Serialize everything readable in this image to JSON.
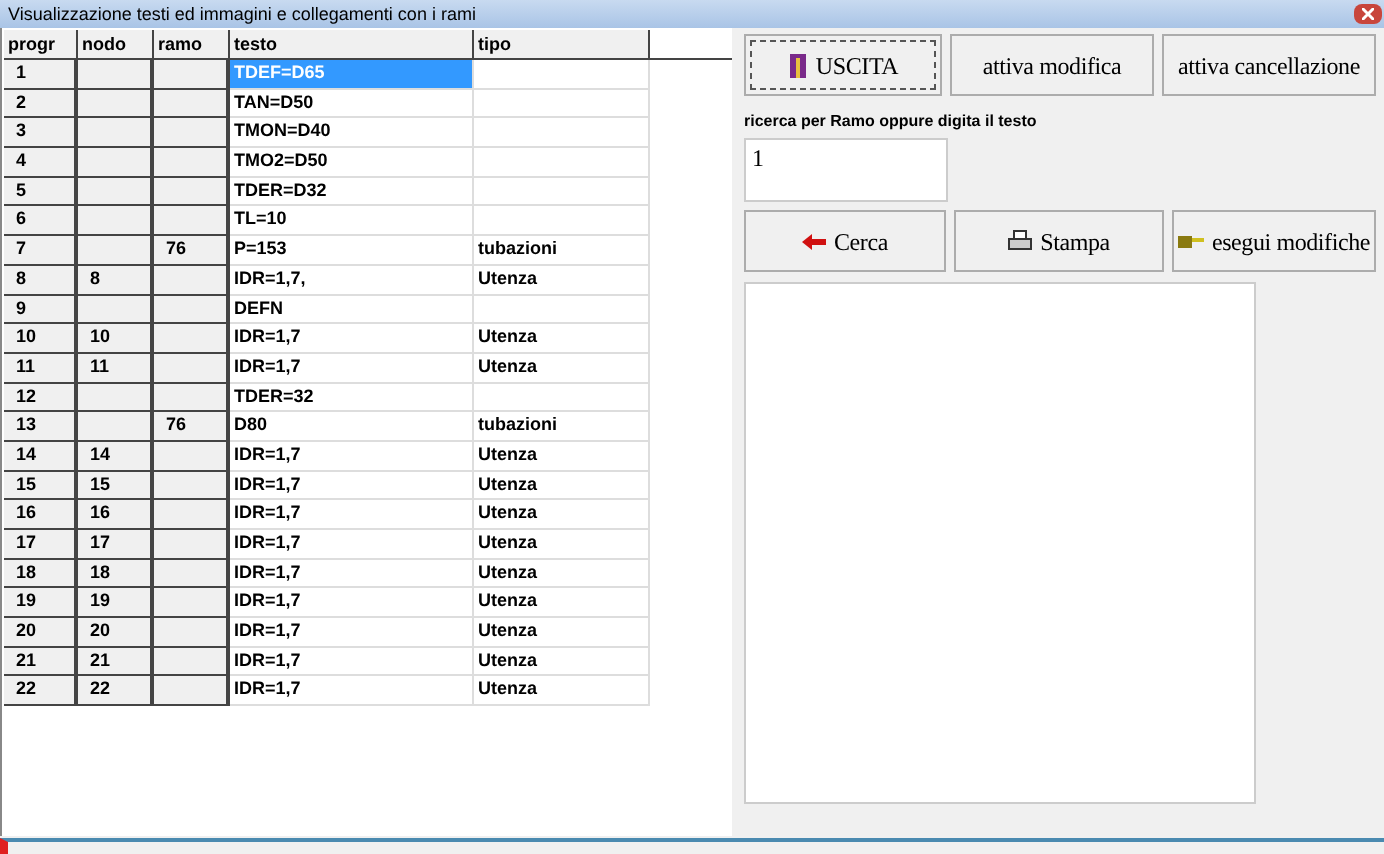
{
  "window": {
    "title": "Visualizzazione testi ed immagini  e collegamenti con i rami"
  },
  "table": {
    "columns": [
      "progr",
      "nodo",
      "ramo",
      "testo",
      "tipo"
    ],
    "rows": [
      {
        "progr": "1",
        "nodo": "",
        "ramo": "",
        "testo": "TDEF=D65",
        "tipo": "",
        "selected": true
      },
      {
        "progr": "2",
        "nodo": "",
        "ramo": "",
        "testo": "TAN=D50",
        "tipo": "",
        "selected": false
      },
      {
        "progr": "3",
        "nodo": "",
        "ramo": "",
        "testo": "TMON=D40",
        "tipo": "",
        "selected": false
      },
      {
        "progr": "4",
        "nodo": "",
        "ramo": "",
        "testo": "TMO2=D50",
        "tipo": "",
        "selected": false
      },
      {
        "progr": "5",
        "nodo": "",
        "ramo": "",
        "testo": "TDER=D32",
        "tipo": "",
        "selected": false
      },
      {
        "progr": "6",
        "nodo": "",
        "ramo": "",
        "testo": "TL=10",
        "tipo": "",
        "selected": false
      },
      {
        "progr": "7",
        "nodo": "",
        "ramo": "76",
        "testo": "P=153",
        "tipo": "tubazioni",
        "selected": false
      },
      {
        "progr": "8",
        "nodo": "8",
        "ramo": "",
        "testo": "IDR=1,7,",
        "tipo": "Utenza",
        "selected": false
      },
      {
        "progr": "9",
        "nodo": "",
        "ramo": "",
        "testo": "DEFN",
        "tipo": "",
        "selected": false
      },
      {
        "progr": "10",
        "nodo": "10",
        "ramo": "",
        "testo": "IDR=1,7",
        "tipo": "Utenza",
        "selected": false
      },
      {
        "progr": "11",
        "nodo": "11",
        "ramo": "",
        "testo": "IDR=1,7",
        "tipo": "Utenza",
        "selected": false
      },
      {
        "progr": "12",
        "nodo": "",
        "ramo": "",
        "testo": "TDER=32",
        "tipo": "",
        "selected": false
      },
      {
        "progr": "13",
        "nodo": "",
        "ramo": "76",
        "testo": "D80",
        "tipo": "tubazioni",
        "selected": false
      },
      {
        "progr": "14",
        "nodo": "14",
        "ramo": "",
        "testo": "IDR=1,7",
        "tipo": "Utenza",
        "selected": false
      },
      {
        "progr": "15",
        "nodo": "15",
        "ramo": "",
        "testo": "IDR=1,7",
        "tipo": "Utenza",
        "selected": false
      },
      {
        "progr": "16",
        "nodo": "16",
        "ramo": "",
        "testo": "IDR=1,7",
        "tipo": "Utenza",
        "selected": false
      },
      {
        "progr": "17",
        "nodo": "17",
        "ramo": "",
        "testo": "IDR=1,7",
        "tipo": "Utenza",
        "selected": false
      },
      {
        "progr": "18",
        "nodo": "18",
        "ramo": "",
        "testo": "IDR=1,7",
        "tipo": "Utenza",
        "selected": false
      },
      {
        "progr": "19",
        "nodo": "19",
        "ramo": "",
        "testo": "IDR=1,7",
        "tipo": "Utenza",
        "selected": false
      },
      {
        "progr": "20",
        "nodo": "20",
        "ramo": "",
        "testo": "IDR=1,7",
        "tipo": "Utenza",
        "selected": false
      },
      {
        "progr": "21",
        "nodo": "21",
        "ramo": "",
        "testo": "IDR=1,7",
        "tipo": "Utenza",
        "selected": false
      },
      {
        "progr": "22",
        "nodo": "22",
        "ramo": "",
        "testo": "IDR=1,7",
        "tipo": "Utenza",
        "selected": false
      }
    ]
  },
  "top_buttons": [
    {
      "label": "USCITA",
      "kind": "exit"
    },
    {
      "label": "attiva modifica",
      "kind": "plain"
    },
    {
      "label": "attiva cancellazione",
      "kind": "plain"
    }
  ],
  "search": {
    "label": "ricerca per Ramo oppure digita il testo",
    "value": "1"
  },
  "action_buttons": [
    {
      "label": "Cerca",
      "kind": "search"
    },
    {
      "label": "Stampa",
      "kind": "print"
    },
    {
      "label": "esegui modifiche",
      "kind": "apply"
    }
  ]
}
